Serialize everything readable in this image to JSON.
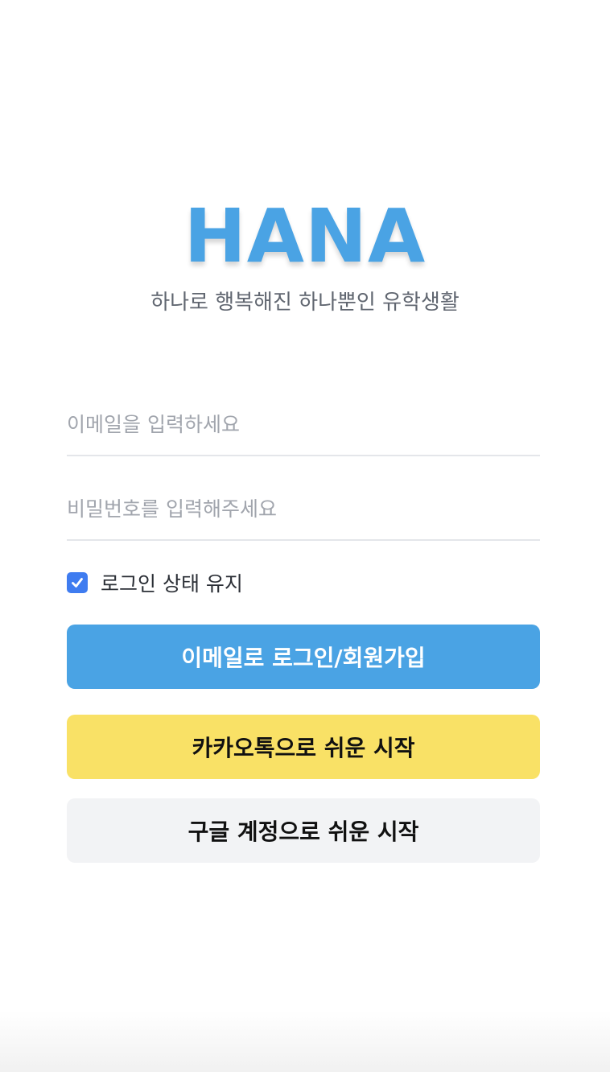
{
  "brand": {
    "logo": "HANA",
    "tagline": "하나로 행복해진 하나뿐인 유학생활"
  },
  "form": {
    "email_placeholder": "이메일을 입력하세요",
    "email_value": "",
    "password_placeholder": "비밀번호를 입력해주세요",
    "password_value": "",
    "remember_label": "로그인 상태 유지",
    "remember_checked": true
  },
  "buttons": {
    "email_login": "이메일로 로그인/회원가입",
    "kakao_start": "카카오톡으로 쉬운 시작",
    "google_start": "구글 계정으로 쉬운 시작"
  },
  "colors": {
    "brand_blue": "#4aa3e4",
    "kakao_yellow": "#f9e166",
    "google_gray": "#f2f3f5",
    "checkbox_blue": "#3f7cf0"
  },
  "icons": {
    "checkbox": "checkmark-icon"
  }
}
